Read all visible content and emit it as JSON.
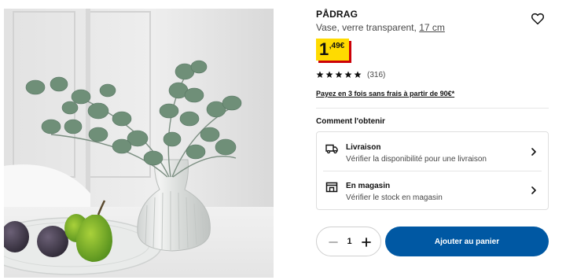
{
  "product": {
    "name": "PÅDRAG",
    "description": "Vase, verre transparent,",
    "size": "17 cm",
    "price_integer": "1",
    "price_decimals": ",49€",
    "rating_stars": 5,
    "review_count": "(316)",
    "financing_text": "Payez en 3 fois sans frais à partir de 90€*"
  },
  "obtain": {
    "title": "Comment l'obtenir",
    "options": [
      {
        "label": "Livraison",
        "detail": "Vérifier la disponibilité pour une livraison",
        "icon": "delivery-truck-icon"
      },
      {
        "label": "En magasin",
        "detail": "Vérifier le stock en magasin",
        "icon": "store-icon"
      }
    ]
  },
  "purchase": {
    "quantity": "1",
    "add_to_cart_label": "Ajouter au panier"
  },
  "colors": {
    "price_badge": "#ffdb00",
    "price_badge_shadow": "#cc0008",
    "primary_button": "#0058a3"
  }
}
